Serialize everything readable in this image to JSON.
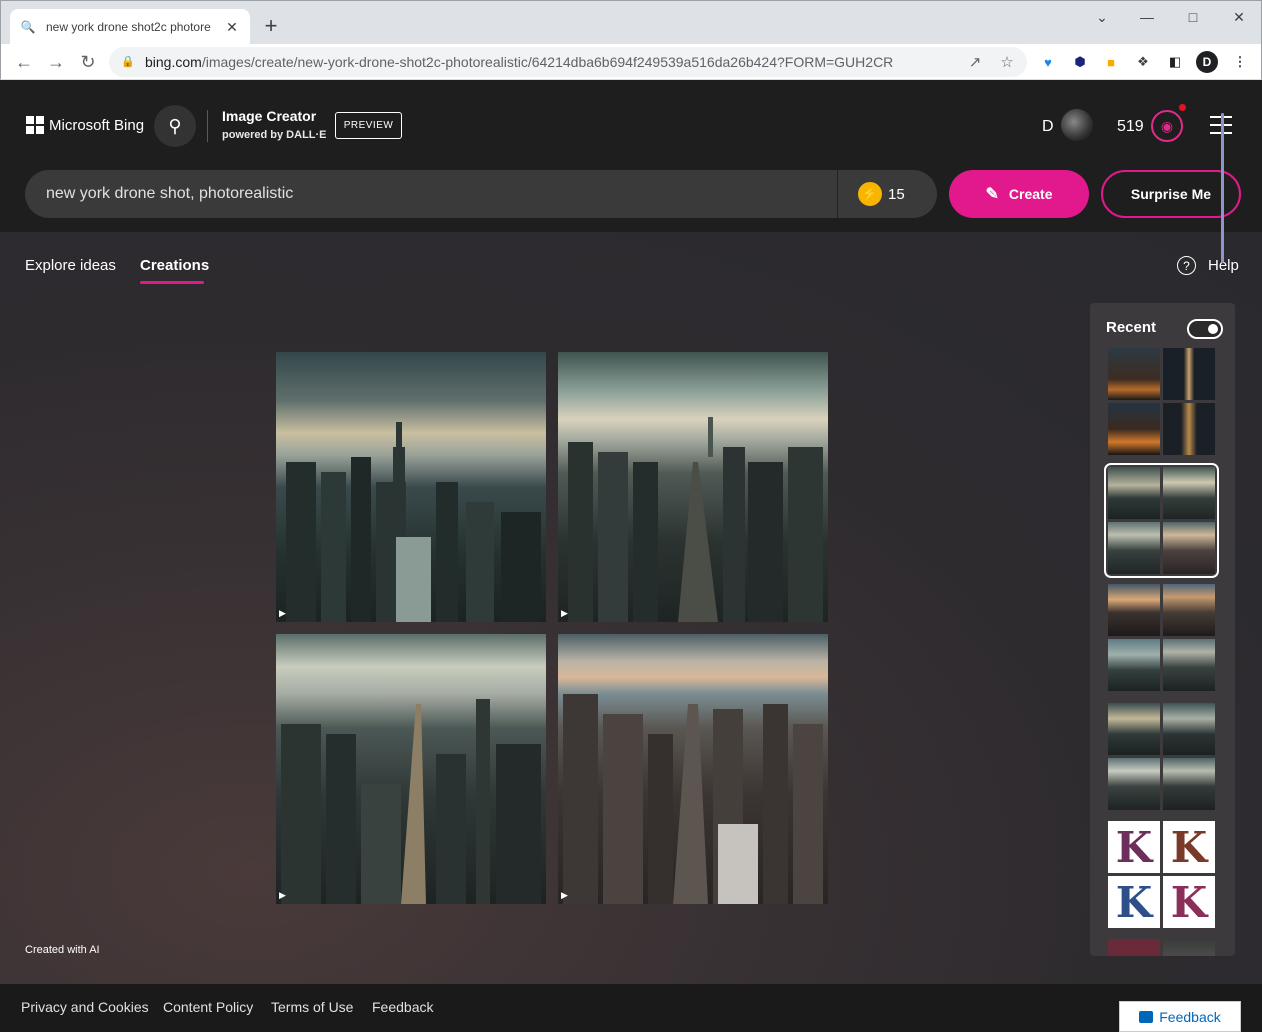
{
  "browser": {
    "tab_title": "new york drone shot2c photore",
    "url_domain": "bing.com",
    "url_path": "/images/create/new-york-drone-shot2c-photorealistic/64214dba6b694f249539a516da26b424?FORM=GUH2CR",
    "profile_initial": "D"
  },
  "header": {
    "brand": "Microsoft Bing",
    "product_title": "Image Creator",
    "product_subtitle": "powered by DALL·E",
    "badge": "PREVIEW",
    "user_initial": "D",
    "points": "519"
  },
  "prompt": {
    "text": "new york drone shot, photorealistic",
    "boost_count": "15",
    "create_label": "Create",
    "surprise_label": "Surprise Me"
  },
  "nav": {
    "explore_label": "Explore ideas",
    "creations_label": "Creations",
    "help_label": "Help"
  },
  "recent": {
    "title": "Recent",
    "toggle_on": true,
    "k_letter": "K"
  },
  "created_with_ai": "Created with AI",
  "footer": {
    "links": [
      "Privacy and Cookies",
      "Content Policy",
      "Terms of Use",
      "Feedback"
    ],
    "feedback_button": "Feedback"
  },
  "colors": {
    "accent": "#e2198c",
    "header_bg": "#1f1e1e",
    "boost": "#f7b500"
  }
}
